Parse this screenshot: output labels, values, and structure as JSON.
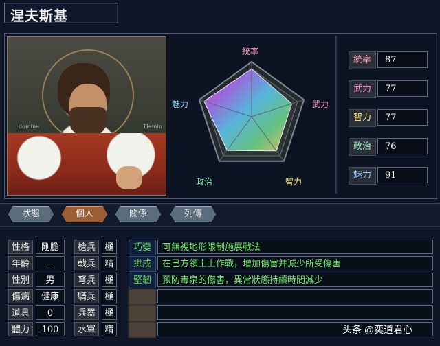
{
  "character": {
    "name": "涅夫斯基",
    "portrait_texts": {
      "left": "domine",
      "right": "Hemin"
    }
  },
  "radar": {
    "labels": [
      "統率",
      "武力",
      "智力",
      "政治",
      "魅力"
    ],
    "values": [
      87,
      77,
      77,
      76,
      91
    ],
    "max": 100,
    "label_colors": [
      "#ff9fb7",
      "#ff8bc5",
      "#ffe97a",
      "#8ef5b6",
      "#8fd2ff"
    ]
  },
  "stats": [
    {
      "label": "統率",
      "value": "87",
      "color": "#ff9ca5"
    },
    {
      "label": "武力",
      "value": "77",
      "color": "#ff8bc8"
    },
    {
      "label": "智力",
      "value": "77",
      "color": "#fff07d"
    },
    {
      "label": "政治",
      "value": "76",
      "color": "#95f3b8"
    },
    {
      "label": "魅力",
      "value": "91",
      "color": "#95d3ff"
    }
  ],
  "tabs": [
    {
      "label": "狀態",
      "active": false
    },
    {
      "label": "個人",
      "active": true
    },
    {
      "label": "關係",
      "active": false
    },
    {
      "label": "列傳",
      "active": false
    }
  ],
  "personal": {
    "rows": [
      {
        "label": "性格",
        "value": "剛膽"
      },
      {
        "label": "年齡",
        "value": "--"
      },
      {
        "label": "性別",
        "value": "男"
      },
      {
        "label": "傷病",
        "value": "健康"
      },
      {
        "label": "道具",
        "value": "0"
      },
      {
        "label": "體力",
        "value": "100"
      }
    ]
  },
  "troops": {
    "rows": [
      {
        "label": "槍兵",
        "value": "極"
      },
      {
        "label": "戟兵",
        "value": "精"
      },
      {
        "label": "弩兵",
        "value": "極"
      },
      {
        "label": "騎兵",
        "value": "極"
      },
      {
        "label": "兵器",
        "value": "極"
      },
      {
        "label": "水軍",
        "value": "精"
      }
    ]
  },
  "skills": [
    {
      "name": "巧變",
      "text": "可無視地形限制施展戰法",
      "visible": true
    },
    {
      "name": "拱戍",
      "text": "在己方領土上作戰，增加傷害并減少所受傷害",
      "visible": true
    },
    {
      "name": "堅韌",
      "text": "預防毒泉的傷害，異常狀態持續時間減少",
      "visible": true
    },
    {
      "name": "",
      "text": "",
      "visible": false
    },
    {
      "name": "",
      "text": "",
      "visible": false
    },
    {
      "name": "",
      "text": "",
      "visible": false
    }
  ],
  "watermark": "头条 @奕道君心"
}
